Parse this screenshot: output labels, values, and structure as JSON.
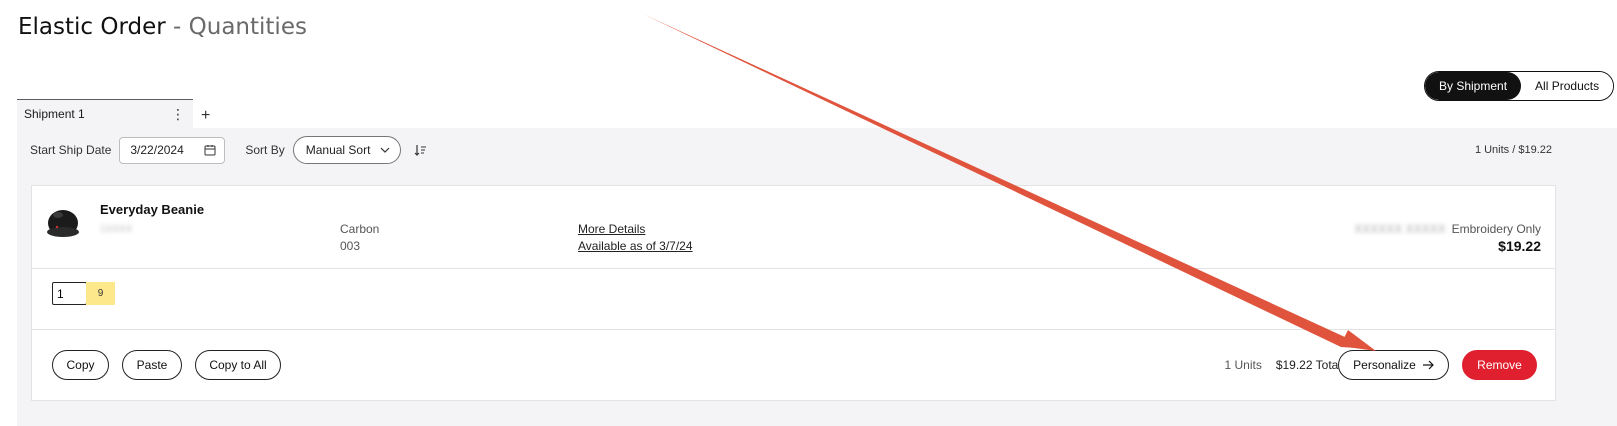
{
  "header": {
    "title": "Elastic Order",
    "subtitle": "- Quantities"
  },
  "view_toggle": {
    "options": [
      "By Shipment",
      "All Products"
    ],
    "selected": "By Shipment"
  },
  "tabs": [
    {
      "label": "Shipment 1",
      "active": true
    }
  ],
  "toolbar": {
    "start_ship_label": "Start Ship Date",
    "start_ship_value": "3/22/2024",
    "sort_label": "Sort By",
    "sort_value": "Manual Sort",
    "summary": "1 Units / $19.22"
  },
  "product": {
    "name": "Everyday Beanie",
    "sku": "1XXXX",
    "color_name": "Carbon",
    "color_code": "003",
    "more_details": "More Details",
    "availability": "Available as of 3/7/24",
    "decoration_code": "XXXXXX XXXXX",
    "decoration": "Embroidery Only",
    "price": "$19.22",
    "quantity": "1",
    "available_qty": "9"
  },
  "actions": {
    "copy": "Copy",
    "paste": "Paste",
    "copy_all": "Copy to All",
    "units": "1 Units",
    "total": "$19.22 Total",
    "personalize": "Personalize",
    "remove": "Remove"
  },
  "colors": {
    "accent_black": "#111111",
    "remove_red": "#e01f2f",
    "annotation_arrow": "#e0533c",
    "availability_yellow": "#fde98b"
  },
  "icons": [
    "calendar-icon",
    "chevron-down-icon",
    "sort-direction-icon",
    "kebab-icon",
    "plus-icon",
    "arrow-right-icon"
  ]
}
